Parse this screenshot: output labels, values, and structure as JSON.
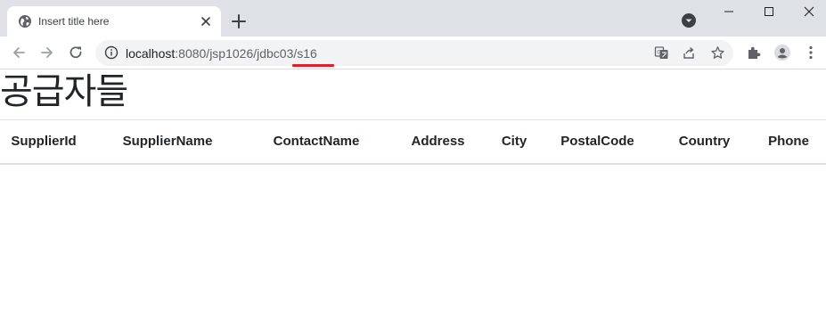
{
  "browser": {
    "tab": {
      "title": "Insert title here"
    },
    "address": {
      "host": "localhost",
      "path": ":8080/jsp1026/jdbc03/s16"
    }
  },
  "page": {
    "title": "공급자들",
    "table": {
      "headers": [
        "SupplierId",
        "SupplierName",
        "ContactName",
        "Address",
        "City",
        "PostalCode",
        "Country",
        "Phone"
      ]
    }
  }
}
